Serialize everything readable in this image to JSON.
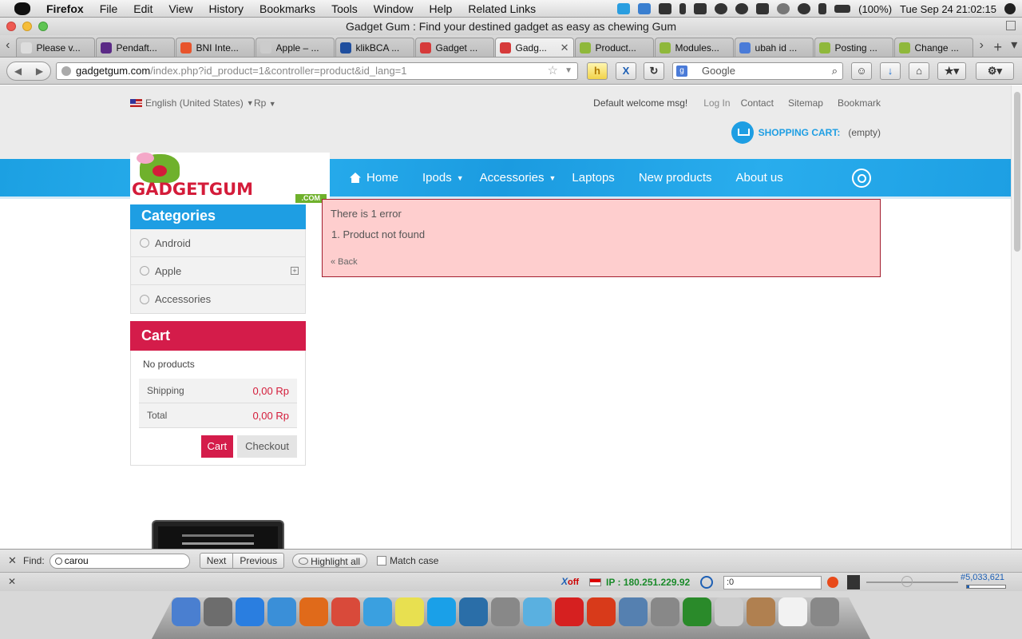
{
  "menubar": {
    "app": "Firefox",
    "items": [
      "File",
      "Edit",
      "View",
      "History",
      "Bookmarks",
      "Tools",
      "Window",
      "Help",
      "Related Links"
    ],
    "battery": "(100%)",
    "clock": "Tue Sep 24  21:02:15"
  },
  "window": {
    "title": "Gadget Gum : Find your destined gadget as easy as chewing Gum"
  },
  "tabs": [
    {
      "label": "Please v...",
      "color": "#dddddd"
    },
    {
      "label": "Pendaft...",
      "color": "#5b2a86"
    },
    {
      "label": "BNI Inte...",
      "color": "#e8542c"
    },
    {
      "label": "Apple – ...",
      "color": "#cccccc"
    },
    {
      "label": "klikBCA ...",
      "color": "#1f4e9e"
    },
    {
      "label": "Gadget ...",
      "color": "#d63a3a"
    },
    {
      "label": "Gadg...",
      "color": "#d63a3a",
      "active": true
    },
    {
      "label": "Product...",
      "color": "#8fb83b"
    },
    {
      "label": "Modules...",
      "color": "#8fb83b"
    },
    {
      "label": "ubah id ...",
      "color": "#4a7bd8"
    },
    {
      "label": "Posting ...",
      "color": "#8fb83b"
    },
    {
      "label": "Change ...",
      "color": "#8fb83b"
    }
  ],
  "nav": {
    "url_host": "gadgetgum.com",
    "url_path": "/index.php?id_product=1&controller=product&id_lang=1",
    "search_placeholder": "Google"
  },
  "site": {
    "language": "English (United States)",
    "currency": "Rp",
    "welcome": "Default welcome msg!",
    "login": "Log In",
    "links": [
      "Contact",
      "Sitemap",
      "Bookmark"
    ],
    "cart_label": "SHOPPING CART:",
    "cart_status": "(empty)",
    "logo_text": "GADGETGUM",
    "logo_com": ".COM",
    "menu": [
      "Home",
      "Ipods",
      "Accessories",
      "Laptops",
      "New products",
      "About us"
    ],
    "categories_title": "Categories",
    "categories": [
      "Android",
      "Apple",
      "Accessories"
    ],
    "cart_title": "Cart",
    "no_products": "No products",
    "shipping_label": "Shipping",
    "shipping_value": "0,00 Rp",
    "total_label": "Total",
    "total_value": "0,00 Rp",
    "btn_cart": "Cart",
    "btn_checkout": "Checkout",
    "error_title": "There is 1 error",
    "error_item": "1.  Product not found",
    "back": "« Back"
  },
  "findbar": {
    "label": "Find:",
    "value": "carou",
    "next": "Next",
    "previous": "Previous",
    "highlight": "Highlight all",
    "match_case": "Match case"
  },
  "statusbar": {
    "xoff": "X",
    "xoff_small": "off",
    "ip": "IP : 180.251.229.92",
    "input_value": ":0",
    "rank": "#5,033,621"
  },
  "dock": [
    "#4a7fd0",
    "#6d6d6d",
    "#2a7ee0",
    "#3a8fd8",
    "#e06a1a",
    "#d94a3a",
    "#3aa0e0",
    "#e8e050",
    "#1aa0e8",
    "#2a6ea8",
    "#888888",
    "#5ab0e0",
    "#d62020",
    "#d83a1a",
    "#5580b0",
    "#888888",
    "#2a8a2a",
    "#cccccc",
    "#b08050",
    "#f2f2f2",
    "#888888"
  ]
}
